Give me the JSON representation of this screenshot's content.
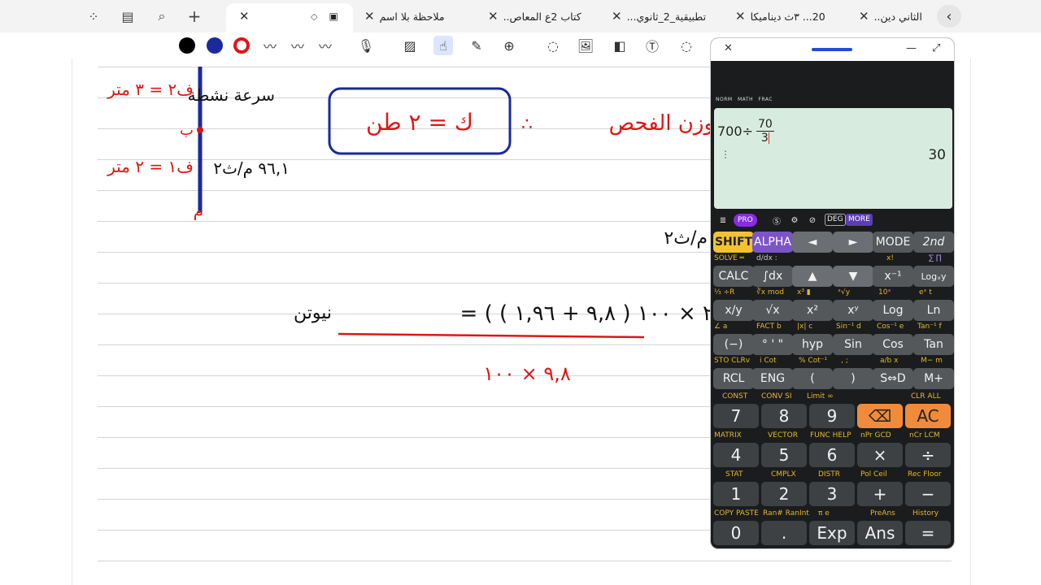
{
  "tabs": [
    {
      "title": "الثاني دين..",
      "close": "✕"
    },
    {
      "title": "20... ٣ث ديناميكا",
      "close": "✕"
    },
    {
      "title": "تطبيقية_2_ثانوي...",
      "close": "✕"
    },
    {
      "title": "كتاب 2ع المعاص..",
      "close": "✕"
    },
    {
      "title": "ملاحظة بلا اسم",
      "close": "✕"
    },
    {
      "title": "",
      "close": "✕"
    }
  ],
  "active_tab_index": 5,
  "tabbar_icons": [
    "grid-icon",
    "sidebar-icon",
    "search-icon",
    "add-icon"
  ],
  "toolbar": {
    "pen_colors": [
      "#000000",
      "#1a2a9c",
      "#e01515"
    ],
    "tools": [
      "pen-icon",
      "pen-icon",
      "pen-icon",
      "mic-icon",
      "hatch-icon",
      "touch-icon",
      "pointer-icon",
      "zoom-icon",
      "lasso-icon",
      "image-icon",
      "shape-icon",
      "text-icon",
      "circle-select-icon"
    ]
  },
  "notes": {
    "line1_left": "سرعة نشطة",
    "f2_3m": "ف٢ = ٣ متر",
    "point_b": "ب",
    "f1_2m": "ف١ = ٢ متر",
    "accel": "٩٦,١ م/ث٢",
    "point_m": "م",
    "boxed": "ك = ٢ طن",
    "therefore": "∴",
    "weight": "وزن الفحص",
    "unit_ms2": "م/ث٢",
    "equation_num": "= ( ٢ × ١٠٠ ( ٩,٨ + ١,٩٦ )",
    "newton": "نيوتن",
    "equation_den": "٩,٨ × ١٠٠"
  },
  "calculator": {
    "head_close": "✕",
    "head_min": "—",
    "head_resize": "⤢",
    "screen_labels": [
      "NORM",
      "MATH",
      "FRAC"
    ],
    "expr_left": "700÷",
    "frac_num": "70",
    "frac_den": "3",
    "result": "30",
    "menu": {
      "pro": "PRO",
      "deg": "DEG",
      "more": "MORE"
    },
    "rows": [
      {
        "sub": [],
        "keys": [
          "SHIFT",
          "ALPHA",
          "◄",
          "►",
          "MODE",
          "2nd"
        ]
      },
      {
        "sub": [
          "SOLVE ═",
          "d/dx :",
          "",
          "",
          "x!",
          "∑ ∏"
        ],
        "keys": [
          "CALC",
          "∫dx",
          "▲",
          "▼",
          "x⁻¹",
          "Logₓy"
        ]
      },
      {
        "sub": [
          "⅓ ÷R",
          "∛x mod",
          "x³ ▮",
          "ˣ√y",
          "10ˣ",
          "eˣ t"
        ],
        "keys": [
          "x/y",
          "√x",
          "x²",
          "xʸ",
          "Log",
          "Ln"
        ]
      },
      {
        "sub": [
          "∠ a",
          "FACT b",
          "|x| c",
          "Sin⁻¹ d",
          "Cos⁻¹ e",
          "Tan⁻¹ f"
        ],
        "keys": [
          "(−)",
          "° ' \"",
          "hyp",
          "Sin",
          "Cos",
          "Tan"
        ]
      },
      {
        "sub": [
          "STO CLRv",
          "i Cot",
          "% Cot⁻¹",
          ", ;",
          "a/b x",
          "M− m"
        ],
        "keys": [
          "RCL",
          "ENG",
          "(",
          ")",
          "S⇔D",
          "M+"
        ]
      },
      {
        "sub": [
          "CONST",
          "CONV SI",
          "Limit ∞",
          "",
          "",
          "CLR ALL"
        ],
        "keys": [
          "7",
          "8",
          "9",
          "⌫",
          "AC"
        ]
      },
      {
        "sub": [
          "MATRIX",
          "VECTOR",
          "FUNC HELP",
          "nPr GCD",
          "nCr LCM"
        ],
        "keys": [
          "4",
          "5",
          "6",
          "×",
          "÷"
        ]
      },
      {
        "sub": [
          "STAT",
          "CMPLX",
          "DISTR",
          "Pol Ceil",
          "Rec Floor"
        ],
        "keys": [
          "1",
          "2",
          "3",
          "+",
          "−"
        ]
      },
      {
        "sub": [
          "COPY PASTE",
          "Ran# RanInt",
          "π e",
          "PreAns",
          "History"
        ],
        "keys": [
          "0",
          ".",
          "Exp",
          "Ans",
          "="
        ]
      }
    ]
  }
}
